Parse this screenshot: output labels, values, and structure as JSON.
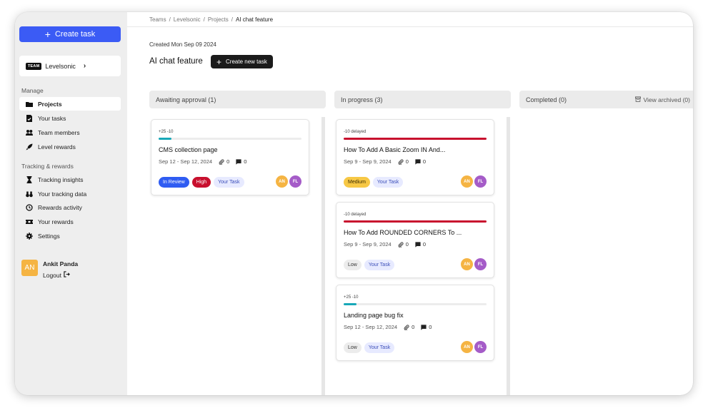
{
  "sidebar": {
    "create_task_label": "Create task",
    "team": {
      "badge": "TEAM",
      "name": "Levelsonic"
    },
    "manage_title": "Manage",
    "manage_items": [
      {
        "label": "Projects",
        "icon": "folder-icon",
        "active": true
      },
      {
        "label": "Your tasks",
        "icon": "task-doc-icon"
      },
      {
        "label": "Team members",
        "icon": "team-icon"
      },
      {
        "label": "Level rewards",
        "icon": "rocket-icon"
      }
    ],
    "tracking_title": "Tracking & rewards",
    "tracking_items": [
      {
        "label": "Tracking insights",
        "icon": "hourglass-icon"
      },
      {
        "label": "Your tracking data",
        "icon": "binoculars-icon"
      },
      {
        "label": "Rewards activity",
        "icon": "history-icon"
      },
      {
        "label": "Your rewards",
        "icon": "ticket-icon"
      },
      {
        "label": "Settings",
        "icon": "gear-icon"
      }
    ],
    "user": {
      "initials": "AN",
      "name": "Ankit Panda",
      "logout": "Logout"
    }
  },
  "breadcrumb": [
    "Teams",
    "Levelsonic",
    "Projects",
    "AI chat feature"
  ],
  "project": {
    "created": "Created Mon Sep 09 2024",
    "title": "AI chat feature",
    "new_task_label": "Create new task"
  },
  "columns": [
    {
      "label": "Awaiting approval (1)"
    },
    {
      "label": "In progress (3)"
    },
    {
      "label": "Completed (0)",
      "action": "View archived (0)"
    }
  ],
  "cards": [
    {
      "meta": "+25 -10",
      "progress": 0.09,
      "bar_color": "#17a8b8",
      "title": "CMS collection page",
      "dates": "Sep 12 - Sep 12, 2024",
      "attachments": "0",
      "comments": "0",
      "tags": [
        "In Review",
        "High",
        "Your Task"
      ],
      "avatars": [
        "AN",
        "FL"
      ]
    },
    {
      "meta": "-10 delayed",
      "progress": 1.0,
      "bar_color": "#c8102e",
      "title": "How To Add A Basic Zoom IN And...",
      "dates": "Sep 9 - Sep 9, 2024",
      "attachments": "0",
      "comments": "0",
      "tags": [
        "Medium",
        "Your Task"
      ],
      "avatars": [
        "AN",
        "FL"
      ]
    },
    {
      "meta": "-10 delayed",
      "progress": 1.0,
      "bar_color": "#c8102e",
      "title": "How To Add ROUNDED CORNERS To ...",
      "dates": "Sep 9 - Sep 9, 2024",
      "attachments": "0",
      "comments": "0",
      "tags": [
        "Low",
        "Your Task"
      ],
      "avatars": [
        "AN",
        "FL"
      ]
    },
    {
      "meta": "+25 -10",
      "progress": 0.09,
      "bar_color": "#17a8b8",
      "title": "Landing page bug fix",
      "dates": "Sep 12 - Sep 12, 2024",
      "attachments": "0",
      "comments": "0",
      "tags": [
        "Low",
        "Your Task"
      ],
      "avatars": [
        "AN",
        "FL"
      ]
    }
  ]
}
